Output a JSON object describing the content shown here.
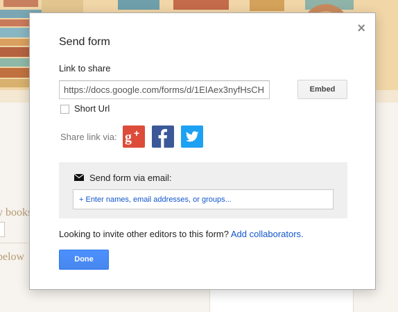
{
  "background": {
    "snippet_1": "y books",
    "snippet_2": "below"
  },
  "dialog": {
    "title": "Send form",
    "close_glyph": "×",
    "link_label": "Link to share",
    "link_value": "https://docs.google.com/forms/d/1EIAex3nyfHsCH",
    "embed_label": "Embed",
    "short_url_label": "Short Url",
    "short_url_checked": false,
    "share_via_label": "Share link via:",
    "share_services": [
      {
        "name": "Google+",
        "icon": "google-plus-icon",
        "color": "#dd4b39"
      },
      {
        "name": "Facebook",
        "icon": "facebook-icon",
        "color": "#3b5998"
      },
      {
        "name": "Twitter",
        "icon": "twitter-icon",
        "color": "#1da1f2"
      }
    ],
    "email_heading": "Send form via email:",
    "email_placeholder": "+ Enter names, email addresses, or groups...",
    "invite_text": "Looking to invite other editors to this form?",
    "invite_link": "Add collaborators.",
    "done_label": "Done"
  },
  "colors": {
    "primary_button": "#4d90fe",
    "link": "#1155cc"
  }
}
